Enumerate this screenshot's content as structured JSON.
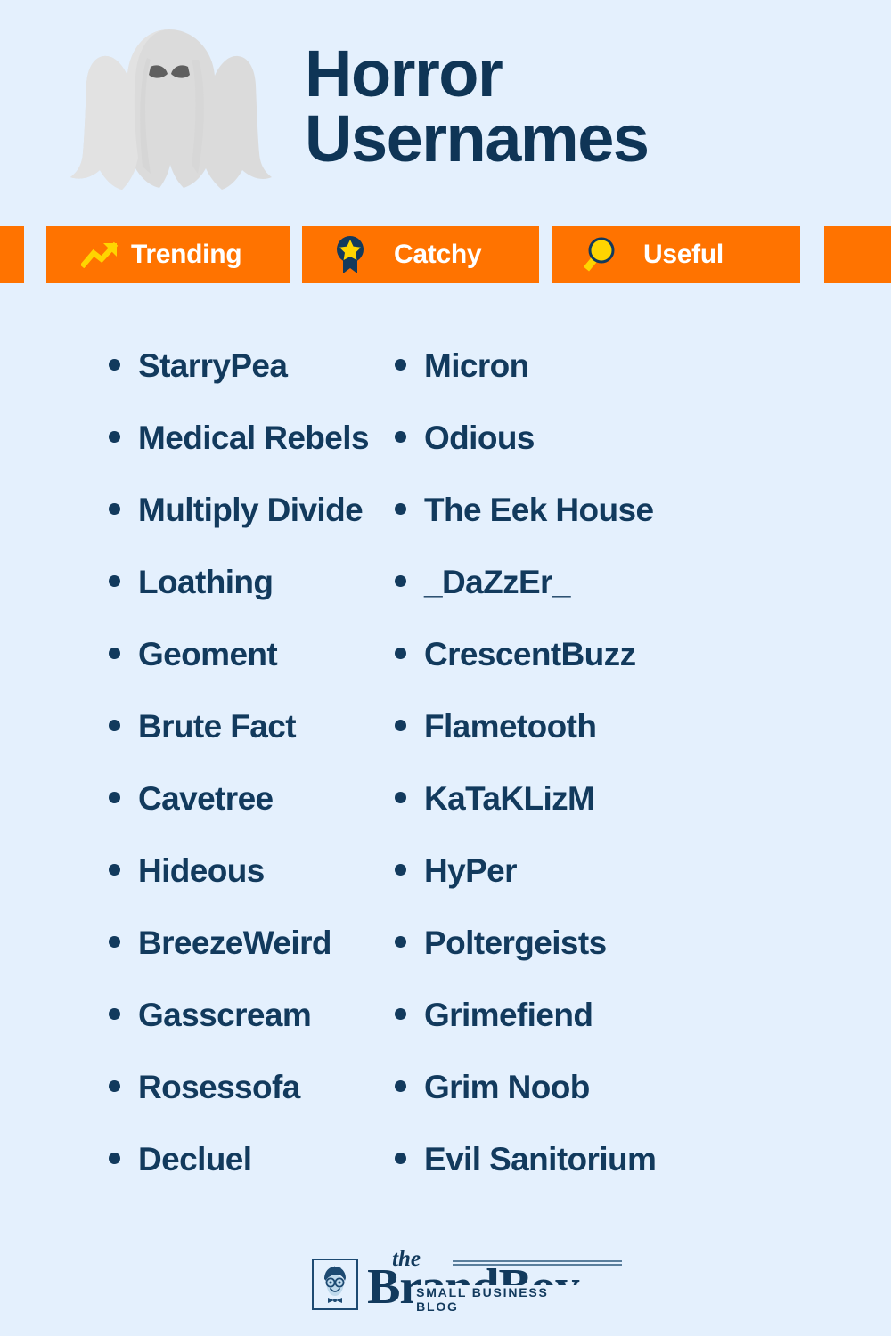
{
  "page": {
    "background_color": "#e4f0fd",
    "accent_color": "#ff7300",
    "text_color": "#123a5d",
    "icon_yellow": "#ffd500"
  },
  "header": {
    "title_line1": "Horror",
    "title_line2": "Usernames",
    "ghost_icon": "ghost-icon"
  },
  "badges": [
    {
      "label": "Trending",
      "icon": "trending-up-icon"
    },
    {
      "label": "Catchy",
      "icon": "award-medal-icon"
    },
    {
      "label": "Useful",
      "icon": "magnifying-glass-icon"
    }
  ],
  "lists": {
    "left_column": [
      {
        "label": "StarryPea"
      },
      {
        "label": "Medical Rebels"
      },
      {
        "label": "Multiply Divide"
      },
      {
        "label": "Loathing"
      },
      {
        "label": "Geoment"
      },
      {
        "label": "Brute Fact"
      },
      {
        "label": "Cavetree"
      },
      {
        "label": "Hideous"
      },
      {
        "label": "BreezeWeird"
      },
      {
        "label": "Gasscream"
      },
      {
        "label": "Rosessofa"
      },
      {
        "label": "Decluel"
      }
    ],
    "right_column": [
      {
        "label": "Micron"
      },
      {
        "label": "Odious"
      },
      {
        "label": "The Eek House"
      },
      {
        "label": "_DaZzEr_"
      },
      {
        "label": "CrescentBuzz"
      },
      {
        "label": "Flametooth"
      },
      {
        "label": "KaTaKLizM"
      },
      {
        "label": "HyPer"
      },
      {
        "label": "Poltergeists"
      },
      {
        "label": "Grimefiend"
      },
      {
        "label": "Grim Noob"
      },
      {
        "label": "Evil Sanitorium"
      }
    ]
  },
  "footer": {
    "logo_the": "the",
    "logo_name": "BrandBoy",
    "logo_tagline": "SMALL BUSINESS BLOG",
    "logo_mark_icon": "boy-face-logo-icon"
  }
}
